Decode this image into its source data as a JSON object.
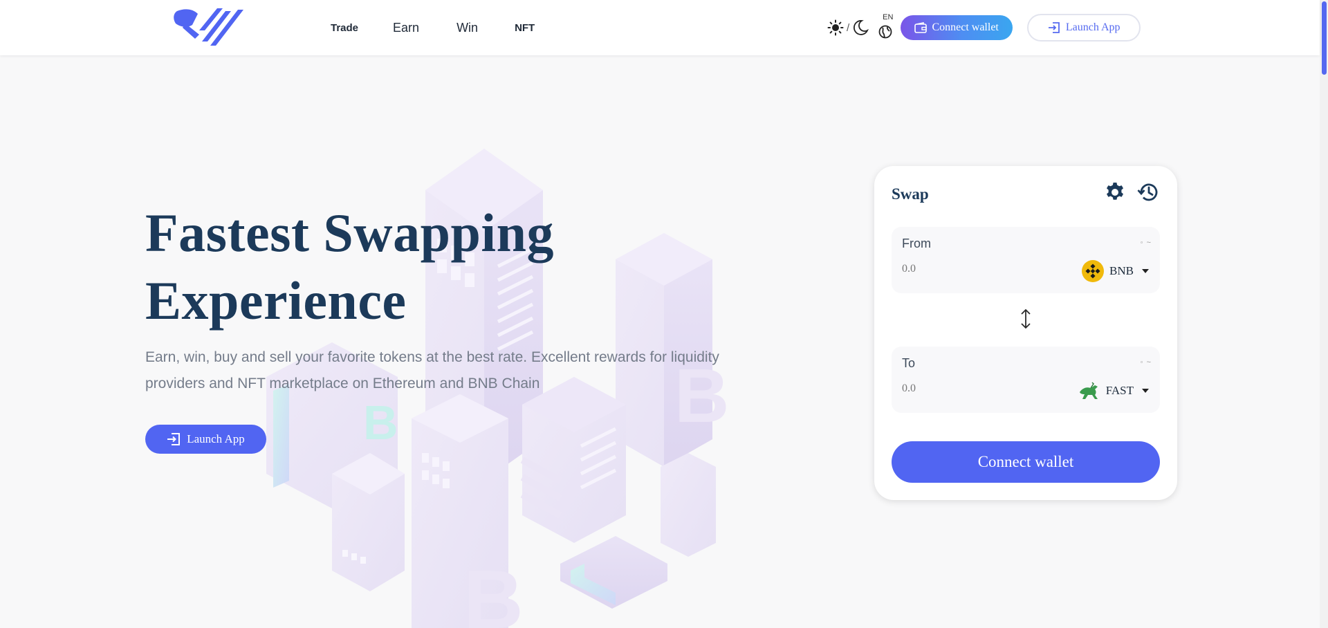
{
  "nav": {
    "trade": "Trade",
    "earn": "Earn",
    "win": "Win",
    "nft": "NFT"
  },
  "header": {
    "theme_separator": "/",
    "language": "EN",
    "connect_wallet": "Connect wallet",
    "launch_app": "Launch App"
  },
  "hero": {
    "title_line1": "Fastest Swapping",
    "title_line2": "Experience",
    "subtitle": "Earn, win, buy and sell your favorite tokens at the best rate. Excellent rewards for liquidity providers and NFT marketplace on Ethereum and BNB Chain",
    "launch_app": "Launch App"
  },
  "swap": {
    "title": "Swap",
    "from": {
      "label": "From",
      "balance": "◦ ~",
      "amount_placeholder": "0.0",
      "token": "BNB"
    },
    "to": {
      "label": "To",
      "balance": "◦ ~",
      "amount_placeholder": "0.0",
      "token": "FAST"
    },
    "connect_wallet": "Connect wallet"
  },
  "colors": {
    "accent": "#5165f2",
    "heading": "#1c3a5a",
    "bnb": "#f0b90b"
  },
  "icons": [
    "logo-icon",
    "sun-icon",
    "moon-icon",
    "globe-icon",
    "wallet-icon",
    "login-icon",
    "gear-icon",
    "history-icon",
    "swap-arrows-icon",
    "bnb-token-icon",
    "fast-token-icon"
  ]
}
